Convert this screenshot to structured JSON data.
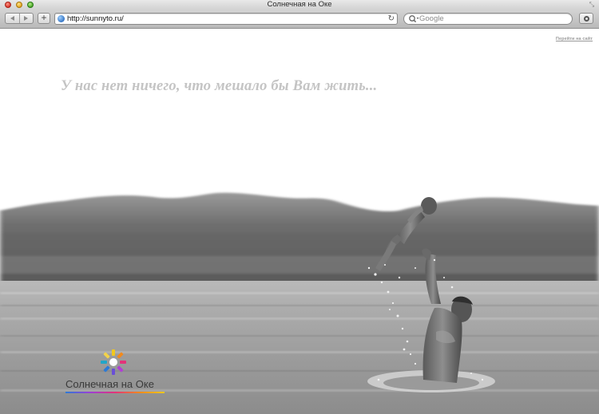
{
  "window": {
    "title": "Солнечная на Оке"
  },
  "toolbar": {
    "back_icon": "chevron-left-icon",
    "forward_icon": "chevron-right-icon",
    "add_label": "+",
    "url": "http://sunnyto.ru/",
    "reload_icon": "↻",
    "search_placeholder": "Google",
    "settings_icon": "gear-icon"
  },
  "page": {
    "enter_link": "Перейти на сайт",
    "tagline": "У нас нет ничего, что мешало бы Вам жить...",
    "logo_text": "Солнечная на Оке",
    "photo": "grayscale-photo-man-throwing-child-in-river"
  },
  "colors": {
    "logo_gradient": [
      "#2c7ad6",
      "#9b3fd6",
      "#e3337a",
      "#f28a1c",
      "#f2c81c"
    ],
    "tagline_color": "#c4c4c4"
  }
}
